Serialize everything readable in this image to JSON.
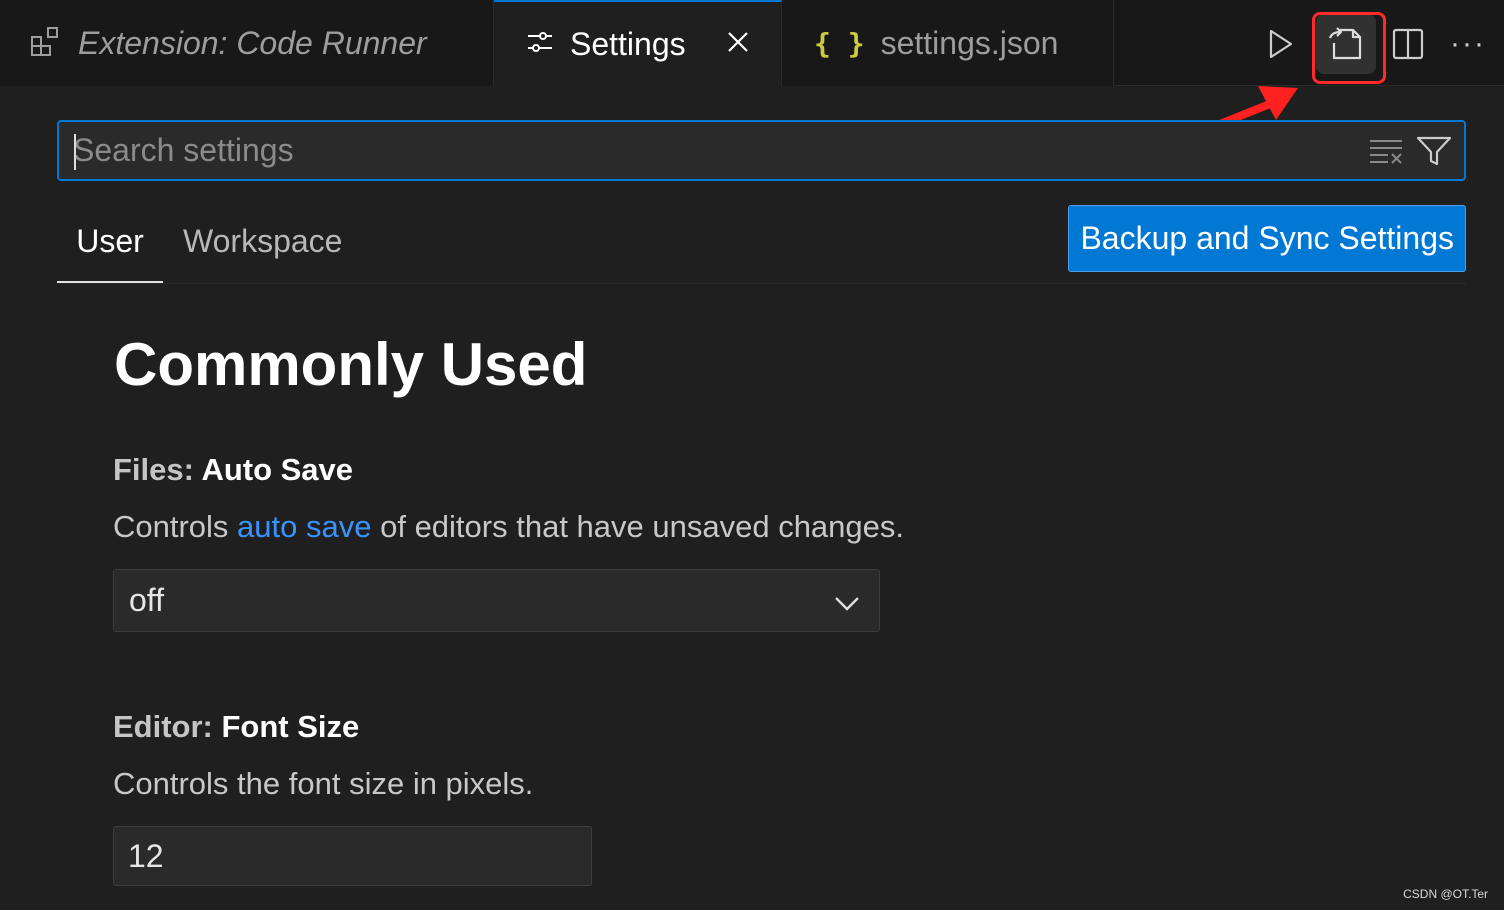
{
  "tabs": {
    "extension": {
      "label": "Extension: Code Runner",
      "icon": "extensions-icon"
    },
    "settings": {
      "label": "Settings",
      "icon": "settings-sliders-icon",
      "close_icon": "close-icon"
    },
    "settings_json": {
      "label": "settings.json",
      "icon": "json-braces-icon",
      "icon_glyph": "{ }",
      "icon_color": "#cbcb41"
    }
  },
  "toolbar_actions": [
    "run-icon",
    "open-settings-json-icon",
    "split-editor-icon",
    "more-actions-icon"
  ],
  "toolbar_more_glyph": "···",
  "highlight_color": "#ff2a2a",
  "search": {
    "placeholder": "Search settings",
    "value": ""
  },
  "scope_tabs": {
    "user": "User",
    "workspace": "Workspace",
    "selected": "User"
  },
  "sync_button": {
    "label": "Backup and Sync Settings",
    "color": "#0078d4"
  },
  "group": {
    "title": "Commonly Used"
  },
  "settings": {
    "auto_save": {
      "category": "Files: ",
      "name": "Auto Save",
      "desc_before": "Controls ",
      "desc_link": "auto save",
      "desc_after": " of editors that have unsaved changes.",
      "value": "off"
    },
    "font_size": {
      "category": "Editor: ",
      "name": "Font Size",
      "desc": "Controls the font size in pixels.",
      "value": "12"
    }
  },
  "watermark": "CSDN @OT.Ter",
  "colors": {
    "accent": "#0078d4",
    "link": "#3794ff",
    "background": "#1f1f1f"
  }
}
